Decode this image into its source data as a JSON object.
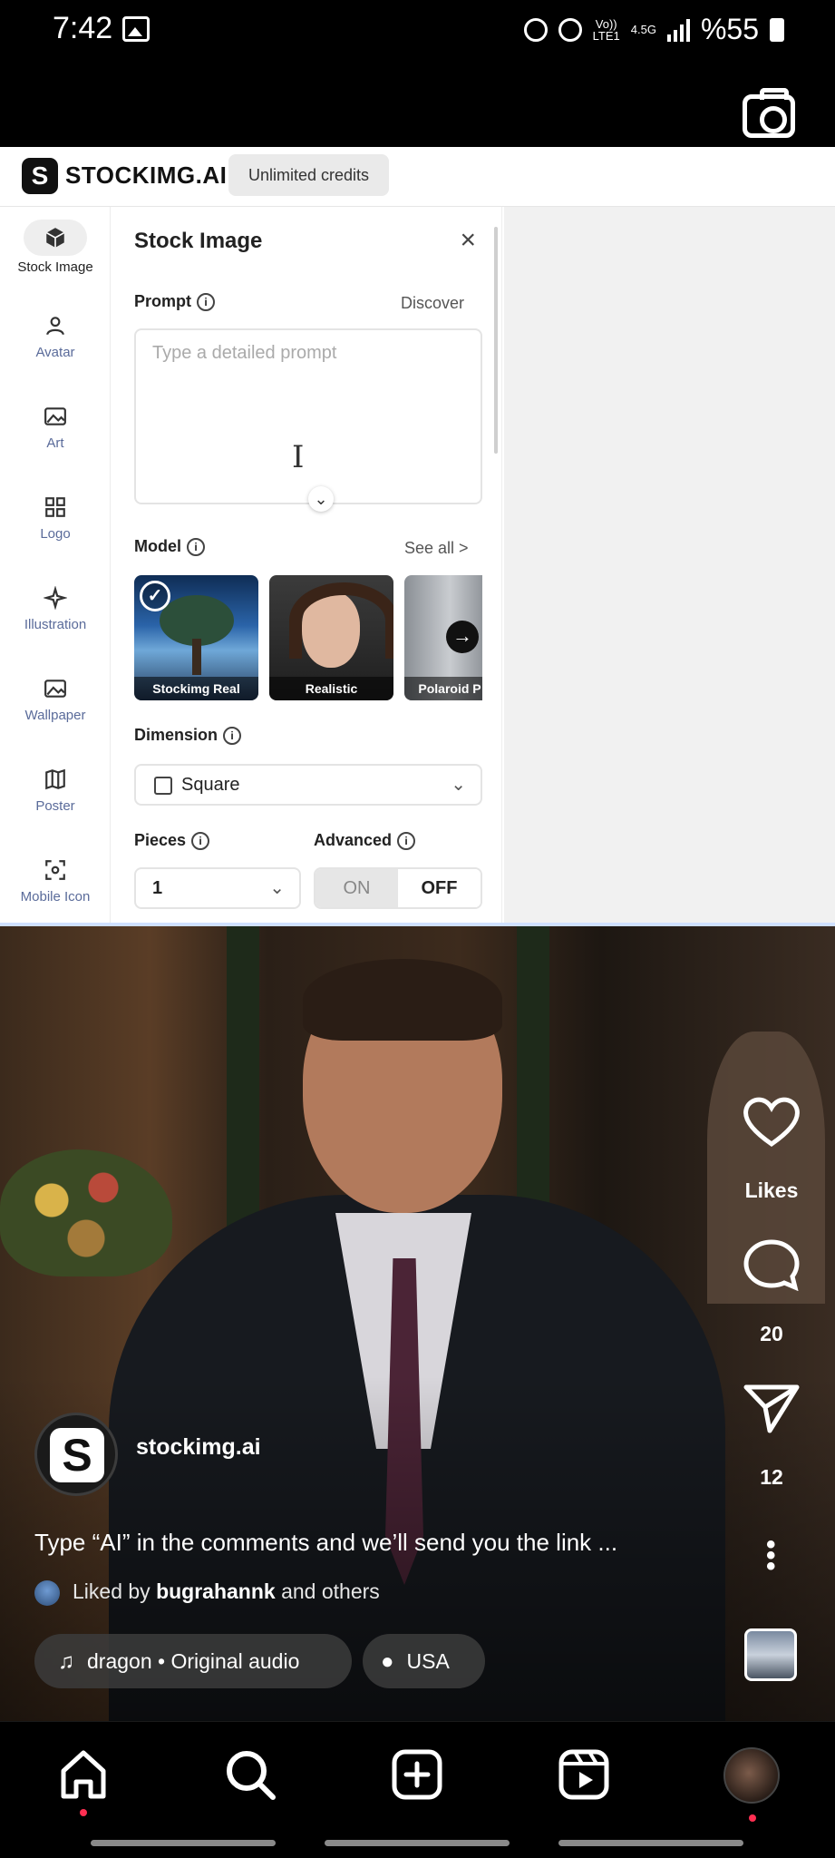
{
  "status_bar": {
    "time": "7:42",
    "network_top": "Vo))",
    "network_bottom": "LTE1",
    "network_gen": "4.5G",
    "battery": "%55"
  },
  "stockimg": {
    "brand": "STOCKIMG.AI",
    "brand_logo_letter": "S",
    "credits_badge": "Unlimited credits",
    "sidebar": [
      {
        "label": "Stock Image",
        "icon": "cube-icon"
      },
      {
        "label": "Avatar",
        "icon": "person-icon"
      },
      {
        "label": "Art",
        "icon": "image-icon"
      },
      {
        "label": "Logo",
        "icon": "grid-icon"
      },
      {
        "label": "Illustration",
        "icon": "sparkle-icon"
      },
      {
        "label": "Wallpaper",
        "icon": "image-icon"
      },
      {
        "label": "Poster",
        "icon": "map-icon"
      },
      {
        "label": "Mobile Icon",
        "icon": "app-icon"
      }
    ],
    "panel": {
      "title": "Stock Image",
      "prompt_label": "Prompt",
      "discover_link": "Discover",
      "prompt_placeholder": "Type a detailed prompt",
      "model_label": "Model",
      "see_all_link": "See all >",
      "models": [
        "Stockimg Real",
        "Realistic",
        "Polaroid P"
      ],
      "dimension_label": "Dimension",
      "dimension_value": "Square",
      "pieces_label": "Pieces",
      "pieces_value": "1",
      "advanced_label": "Advanced",
      "advanced_on": "ON",
      "advanced_off": "OFF"
    }
  },
  "reel": {
    "account_name": "stockimg.ai",
    "account_avatar_letter": "S",
    "caption": "Type “AI” in the comments and we’ll send you the link ...",
    "liked_prefix": "Liked by",
    "liked_user": "bugrahannk",
    "liked_suffix": "and others",
    "likes_label": "Likes",
    "comments_count": "20",
    "shares_count": "12",
    "audio": "dragon • Original audio",
    "location": "USA"
  }
}
